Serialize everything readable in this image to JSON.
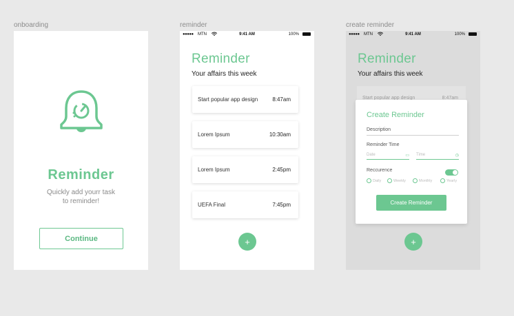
{
  "frames": {
    "onboarding": {
      "label": "onboarding",
      "title": "Reminder",
      "subtitle_line1": "Quickly add yourr task",
      "subtitle_line2": "to reminder!",
      "continue_label": "Continue"
    },
    "reminder": {
      "label": "reminder",
      "title": "Reminder",
      "subtitle": "Your affairs this week",
      "items": [
        {
          "title": "Start popular app design",
          "time": "8:47am"
        },
        {
          "title": "Lorem Ipsum",
          "time": "10:30am"
        },
        {
          "title": "Lorem Ipsum",
          "time": "2:45pm"
        },
        {
          "title": "UEFA Final",
          "time": "7:45pm"
        }
      ],
      "fab_label": "+"
    },
    "create_reminder": {
      "label": "create reminder",
      "title": "Reminder",
      "subtitle": "Your affairs this week",
      "ghost_item": {
        "title": "Start popular app design",
        "time": "8:47am"
      },
      "modal": {
        "title": "Create Reminder",
        "description_label": "Description",
        "reminder_time_label": "Reminder Time",
        "date_placeholder": "Date",
        "time_placeholder": "Time",
        "recurrence_label": "Reccurence",
        "recurrence_enabled": true,
        "options": [
          "Daily",
          "Weekly",
          "Monthly",
          "Yearly"
        ],
        "create_button": "Create Reminder"
      },
      "fab_label": "+"
    }
  },
  "statusbar": {
    "signal": "●●●●●",
    "carrier": "MTN",
    "time": "9:41 AM",
    "battery": "100%"
  },
  "icons": {
    "bell": "bell-clock-icon",
    "wifi": "wifi-icon",
    "battery": "battery-icon",
    "calendar": "calendar-icon",
    "clock": "clock-icon"
  },
  "colors": {
    "accent": "#6cc791",
    "canvas": "#e9e9e9",
    "overlay": "#dcdcdc"
  }
}
